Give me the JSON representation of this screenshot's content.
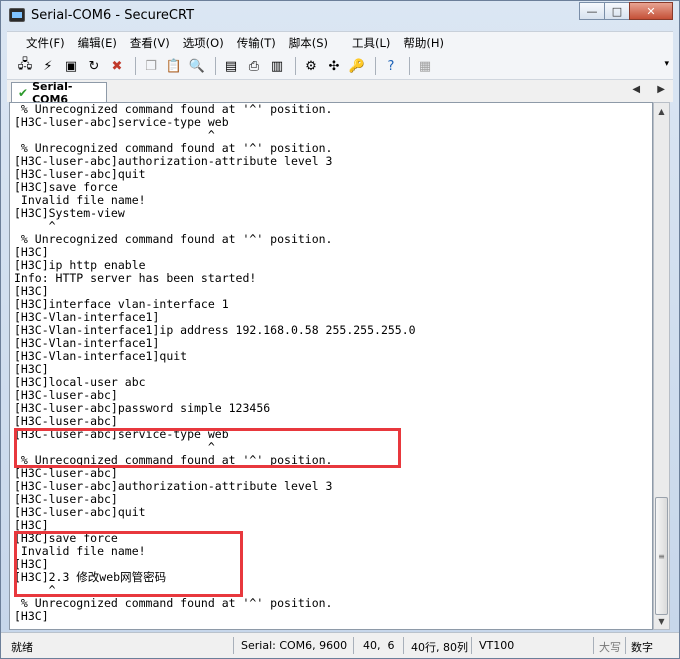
{
  "window": {
    "title": "Serial-COM6 - SecureCRT",
    "controls": {
      "minimize": "—",
      "maximize": "□",
      "close": "✕"
    }
  },
  "menu": [
    "文件(F)",
    "编辑(E)",
    "查看(V)",
    "选项(O)",
    "传输(T)",
    "脚本(S)",
    "工具(L)",
    "帮助(H)"
  ],
  "toolbar": {
    "icons": [
      "connect-icon",
      "quick-connect-icon",
      "connect-tab-icon",
      "reconnect-icon",
      "disconnect-icon",
      "copy-icon",
      "paste-icon",
      "find-icon",
      "print-setup-icon",
      "print-icon",
      "print-screen-icon",
      "session-options-icon",
      "global-options-icon",
      "keymap-icon",
      "help-icon",
      "log-icon"
    ]
  },
  "tab": {
    "label": "Serial-COM6"
  },
  "terminal": {
    "lines": [
      " % Unrecognized command found at '^' position.",
      "[H3C-luser-abc]service-type web",
      "                            ^",
      " % Unrecognized command found at '^' position.",
      "[H3C-luser-abc]authorization-attribute level 3",
      "[H3C-luser-abc]quit",
      "[H3C]save force",
      " Invalid file name!",
      "[H3C]System-view",
      "     ^",
      " % Unrecognized command found at '^' position.",
      "[H3C]",
      "[H3C]ip http enable",
      "Info: HTTP server has been started!",
      "[H3C]",
      "[H3C]interface vlan-interface 1",
      "[H3C-Vlan-interface1]",
      "[H3C-Vlan-interface1]ip address 192.168.0.58 255.255.255.0",
      "[H3C-Vlan-interface1]",
      "[H3C-Vlan-interface1]quit",
      "[H3C]",
      "[H3C]local-user abc",
      "[H3C-luser-abc]",
      "[H3C-luser-abc]password simple 123456",
      "[H3C-luser-abc]",
      "[H3C-luser-abc]service-type web",
      "                            ^",
      " % Unrecognized command found at '^' position.",
      "[H3C-luser-abc]",
      "[H3C-luser-abc]authorization-attribute level 3",
      "[H3C-luser-abc]",
      "[H3C-luser-abc]quit",
      "[H3C]",
      "[H3C]save force",
      " Invalid file name!",
      "[H3C]",
      "[H3C]2.3 修改web网管密码",
      "     ^",
      " % Unrecognized command found at '^' position.",
      "[H3C]"
    ]
  },
  "annotation_color": "#e8383d",
  "status": {
    "ready": "就绪",
    "connection": "Serial: COM6, 9600",
    "cursor": "40,  6",
    "size": "40行, 80列",
    "terminal_type": "VT100",
    "caps": "大写",
    "num": "数字"
  }
}
